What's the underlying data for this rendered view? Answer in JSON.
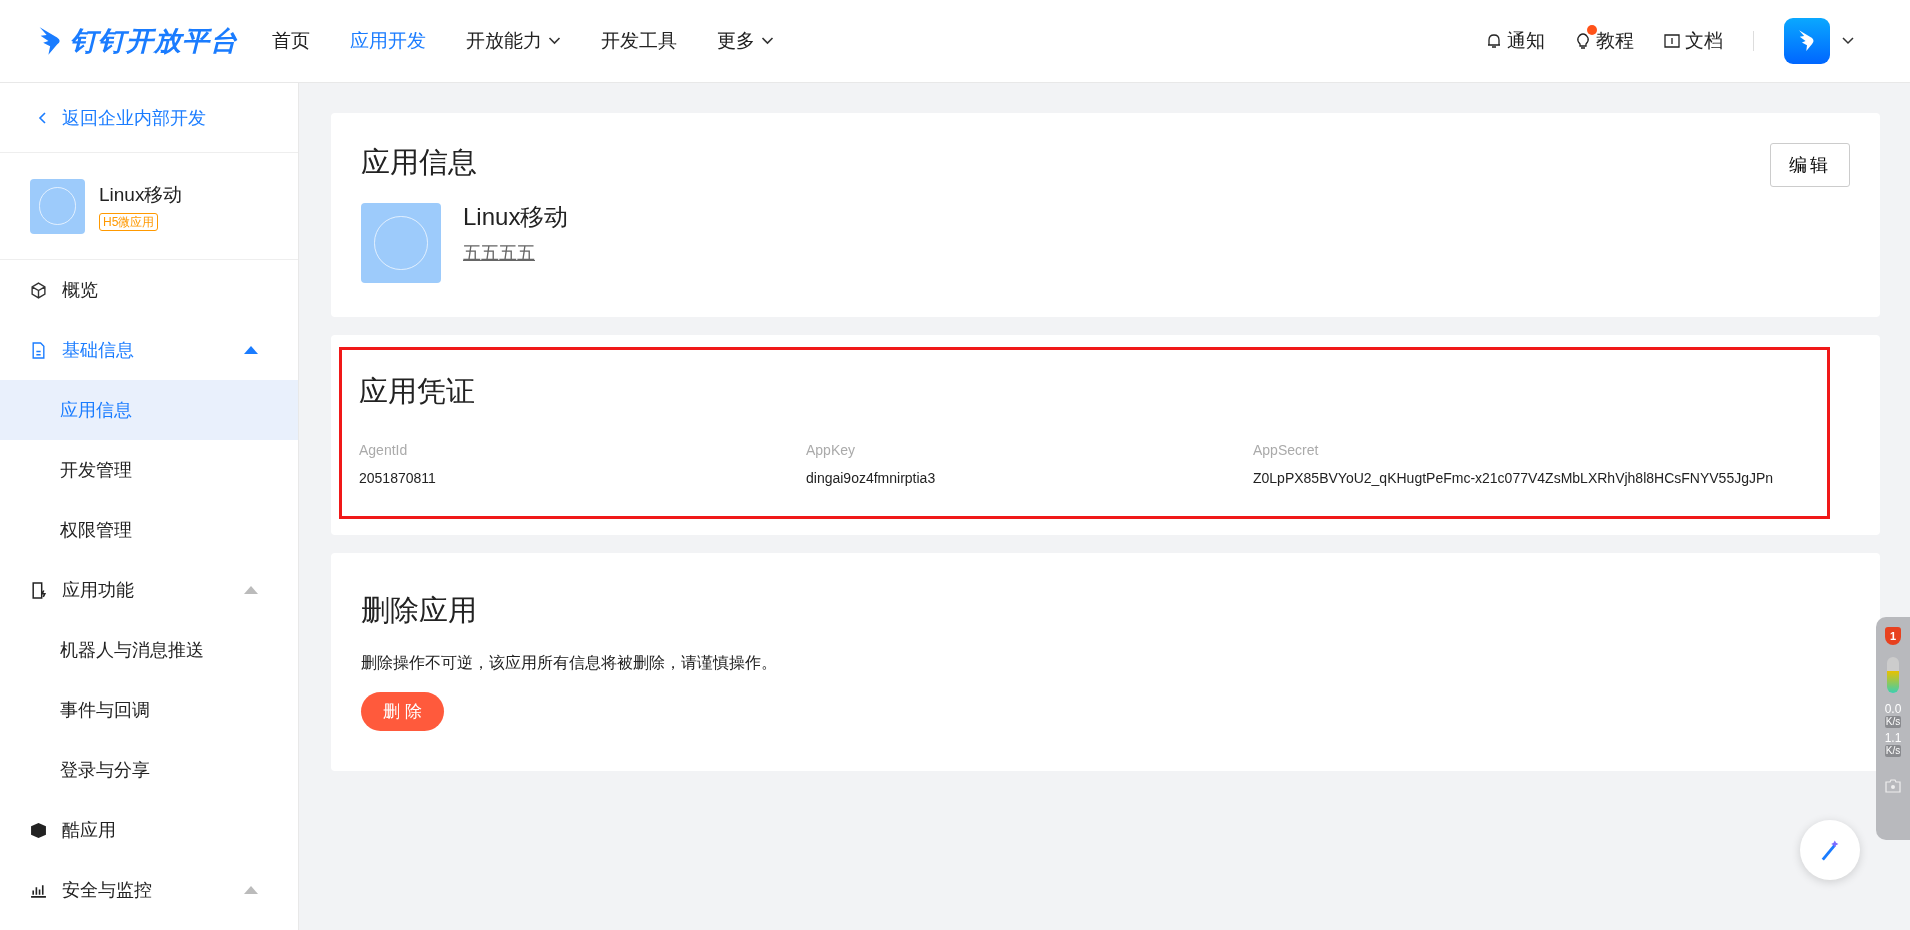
{
  "header": {
    "logo_text": "钉钉开放平台",
    "nav": [
      {
        "label": "首页",
        "selected": false,
        "dropdown": false
      },
      {
        "label": "应用开发",
        "selected": true,
        "dropdown": false
      },
      {
        "label": "开放能力",
        "selected": false,
        "dropdown": true
      },
      {
        "label": "开发工具",
        "selected": false,
        "dropdown": false
      },
      {
        "label": "更多",
        "selected": false,
        "dropdown": true
      }
    ],
    "links": [
      {
        "label": "通知",
        "dot": false
      },
      {
        "label": "教程",
        "dot": true
      },
      {
        "label": "文档",
        "dot": false
      }
    ]
  },
  "sidebar": {
    "back": "返回企业内部开发",
    "app_name": "Linux移动",
    "app_tag": "H5微应用",
    "items": [
      {
        "label": "概览",
        "selected": false,
        "expanded": false
      },
      {
        "label": "基础信息",
        "selected": true,
        "expanded": true,
        "children": [
          {
            "label": "应用信息",
            "selected": true
          },
          {
            "label": "开发管理",
            "selected": false
          },
          {
            "label": "权限管理",
            "selected": false
          }
        ]
      },
      {
        "label": "应用功能",
        "selected": false,
        "expanded": true,
        "children": [
          {
            "label": "机器人与消息推送",
            "selected": false
          },
          {
            "label": "事件与回调",
            "selected": false
          },
          {
            "label": "登录与分享",
            "selected": false
          }
        ]
      },
      {
        "label": "酷应用",
        "selected": false,
        "expanded": false
      },
      {
        "label": "安全与监控",
        "selected": false,
        "expanded": true
      }
    ]
  },
  "app_info": {
    "title": "应用信息",
    "edit_button": "编辑",
    "name": "Linux移动",
    "description": "五五五五"
  },
  "credentials": {
    "title": "应用凭证",
    "highlighted": true,
    "fields": [
      {
        "label": "AgentId",
        "value": "2051870811"
      },
      {
        "label": "AppKey",
        "value": "dingai9oz4fmnirptia3"
      },
      {
        "label": "AppSecret",
        "value": "Z0LpPX85BVYoU2_qKHugtPeFmc-x21c077V4ZsMbLXRhVjh8l8HCsFNYV55JgJPn"
      }
    ]
  },
  "delete_app": {
    "title": "删除应用",
    "warning": "删除操作不可逆，该应用所有信息将被删除，请谨慎操作。",
    "button": "删 除"
  },
  "speed_widget": {
    "badge": "1",
    "up_value": "0.0",
    "up_unit": "K/s",
    "down_value": "1.1",
    "down_unit": "K/s"
  }
}
